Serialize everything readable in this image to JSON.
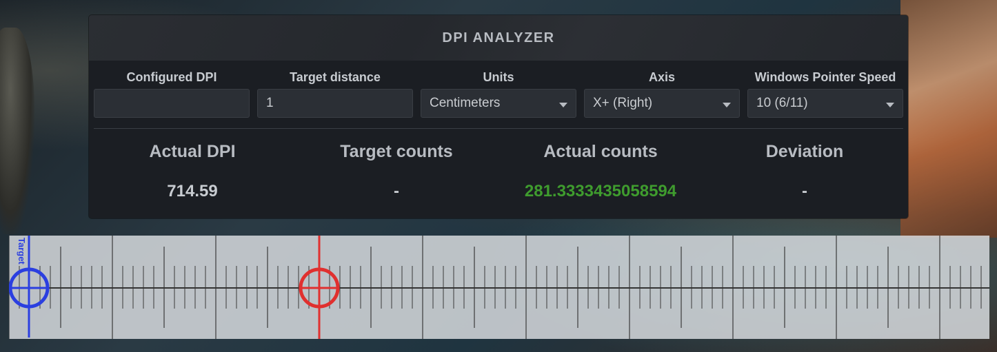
{
  "title": "DPI ANALYZER",
  "fields": {
    "configured_dpi": {
      "label": "Configured DPI",
      "value": ""
    },
    "target_distance": {
      "label": "Target distance",
      "value": "1"
    },
    "units": {
      "label": "Units",
      "value": "Centimeters"
    },
    "axis": {
      "label": "Axis",
      "value": "X+ (Right)"
    },
    "pointer_speed": {
      "label": "Windows Pointer Speed",
      "value": "10 (6/11)"
    }
  },
  "stats": {
    "actual_dpi": {
      "label": "Actual DPI",
      "value": "714.59"
    },
    "target_counts": {
      "label": "Target counts",
      "value": "-"
    },
    "actual_counts": {
      "label": "Actual counts",
      "value": "281.3333435058594"
    },
    "deviation": {
      "label": "Deviation",
      "value": "-"
    }
  },
  "ruler": {
    "target_label": "Target",
    "target_color": "#2b3fe0",
    "cursor_color": "#e0302f"
  },
  "colors": {
    "accent_green": "#3f9c2e"
  },
  "icons": {
    "dropdown": "chevron-down-icon"
  }
}
